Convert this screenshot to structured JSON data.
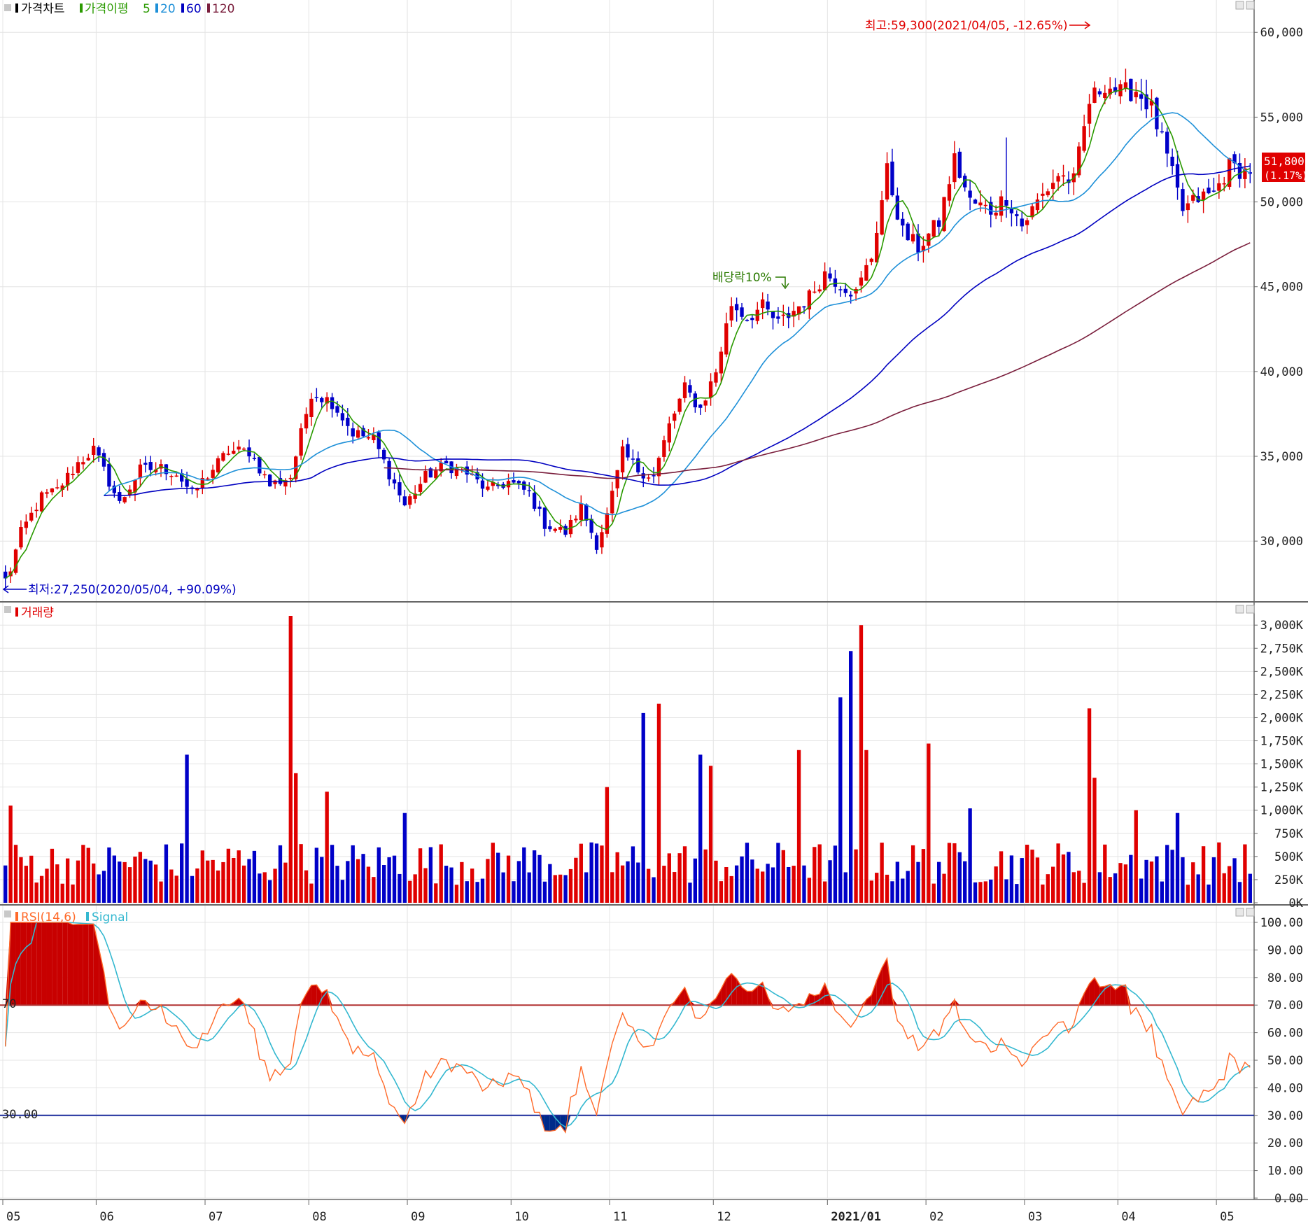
{
  "colors": {
    "up": "#e00000",
    "down": "#0000c8",
    "ma5": "#2a9a00",
    "ma20": "#1e90d8",
    "ma60": "#0000c0",
    "ma120": "#7a1e3c",
    "grid": "#e4e4e4",
    "rsi": "#ff6a2a",
    "signal": "#34b8d0",
    "rsi_hi": "#c80000",
    "rsi_lo": "#002a8a",
    "price_box": "#e00000"
  },
  "price_panel": {
    "legend": {
      "title": "가격차트",
      "ma_label": "가격이평",
      "periods": [
        "5",
        "20",
        "60",
        "120"
      ]
    },
    "high_label": "최고:59,300(2021/04/05, -12.65%)",
    "low_label": "최저:27,250(2020/05/04, +90.09%)",
    "dividend_label": "배당락10%",
    "current_price": "51,800",
    "current_change": "(1.17%)",
    "yticks": [
      "60,000",
      "55,000",
      "50,000",
      "45,000",
      "40,000",
      "35,000",
      "30,000"
    ]
  },
  "volume_panel": {
    "legend": "거래량",
    "yticks": [
      "3,000K",
      "2,750K",
      "2,500K",
      "2,250K",
      "2,000K",
      "1,750K",
      "1,500K",
      "1,250K",
      "1,000K",
      "750K",
      "500K",
      "250K",
      "0K"
    ]
  },
  "rsi_panel": {
    "legend": "RSI(14,6)",
    "signal_label": "Signal",
    "level_70": "70",
    "level_30": "30.00",
    "yticks": [
      "100.00",
      "90.00",
      "80.00",
      "70.00",
      "60.00",
      "50.00",
      "40.00",
      "30.00",
      "20.00",
      "10.00",
      "0.00"
    ]
  },
  "xaxis": {
    "labels": [
      "05",
      "06",
      "07",
      "08",
      "09",
      "10",
      "11",
      "12",
      "2021/01",
      "02",
      "03",
      "04",
      "05"
    ]
  },
  "chart_data": [
    {
      "type": "candlestick",
      "panel": "price",
      "ylim": [
        26500,
        61000
      ],
      "series": [
        {
          "name": "가격차트",
          "anchors": [
            [
              0,
              27250
            ],
            [
              3,
              30500
            ],
            [
              7,
              32600
            ],
            [
              10,
              33000
            ],
            [
              14,
              34600
            ],
            [
              17,
              35400
            ],
            [
              20,
              33500
            ],
            [
              22,
              32200
            ],
            [
              26,
              34200
            ],
            [
              30,
              34300
            ],
            [
              33,
              34000
            ],
            [
              36,
              32800
            ],
            [
              39,
              33900
            ],
            [
              43,
              35300
            ],
            [
              47,
              35300
            ],
            [
              51,
              33300
            ],
            [
              55,
              33800
            ],
            [
              59,
              38800
            ],
            [
              63,
              38200
            ],
            [
              67,
              36400
            ],
            [
              71,
              36000
            ],
            [
              74,
              34000
            ],
            [
              77,
              32100
            ],
            [
              81,
              33800
            ],
            [
              85,
              34500
            ],
            [
              89,
              34000
            ],
            [
              93,
              33000
            ],
            [
              97,
              33500
            ],
            [
              101,
              32800
            ],
            [
              104,
              31000
            ],
            [
              108,
              30500
            ],
            [
              111,
              32000
            ],
            [
              114,
              29800
            ],
            [
              116,
              31500
            ],
            [
              119,
              35200
            ],
            [
              122,
              34200
            ],
            [
              125,
              33800
            ],
            [
              128,
              36800
            ],
            [
              131,
              39000
            ],
            [
              134,
              37800
            ],
            [
              137,
              40000
            ],
            [
              140,
              44000
            ],
            [
              143,
              43200
            ],
            [
              146,
              43800
            ],
            [
              149,
              42800
            ],
            [
              152,
              43600
            ],
            [
              155,
              44400
            ],
            [
              158,
              45800
            ],
            [
              161,
              45200
            ],
            [
              164,
              44600
            ],
            [
              167,
              46800
            ],
            [
              170,
              51800
            ],
            [
              173,
              48200
            ],
            [
              176,
              47300
            ],
            [
              180,
              48800
            ],
            [
              183,
              52500
            ],
            [
              186,
              50000
            ],
            [
              190,
              49500
            ],
            [
              193,
              50300
            ],
            [
              196,
              48600
            ],
            [
              199,
              50000
            ],
            [
              203,
              51600
            ],
            [
              206,
              51200
            ],
            [
              209,
              55900
            ],
            [
              212,
              57000
            ],
            [
              215,
              56400
            ],
            [
              218,
              56600
            ],
            [
              221,
              55500
            ],
            [
              224,
              52600
            ],
            [
              227,
              49500
            ],
            [
              230,
              50200
            ],
            [
              233,
              50500
            ],
            [
              236,
              52100
            ],
            [
              239,
              51800
            ]
          ]
        }
      ]
    },
    {
      "type": "line",
      "panel": "price",
      "series": [
        {
          "name": "5",
          "source": "ma",
          "period": 5
        },
        {
          "name": "20",
          "source": "ma",
          "period": 20
        },
        {
          "name": "60",
          "source": "ma",
          "period": 60
        },
        {
          "name": "120",
          "source": "ma",
          "period": 120
        }
      ]
    },
    {
      "type": "bar",
      "panel": "volume",
      "ylim": [
        0,
        3100000
      ],
      "series": [
        {
          "name": "거래량",
          "peaks": [
            [
              1,
              1050000
            ],
            [
              35,
              1600000
            ],
            [
              55,
              3100000
            ],
            [
              56,
              1400000
            ],
            [
              62,
              1200000
            ],
            [
              77,
              970000
            ],
            [
              116,
              1250000
            ],
            [
              123,
              2050000
            ],
            [
              126,
              2150000
            ],
            [
              134,
              1600000
            ],
            [
              136,
              1480000
            ],
            [
              153,
              1650000
            ],
            [
              161,
              2220000
            ],
            [
              163,
              2720000
            ],
            [
              165,
              3000000
            ],
            [
              166,
              1650000
            ],
            [
              178,
              1720000
            ],
            [
              186,
              1020000
            ],
            [
              209,
              2100000
            ],
            [
              210,
              1350000
            ],
            [
              218,
              1000000
            ],
            [
              226,
              970000
            ]
          ],
          "base": 430000
        }
      ]
    },
    {
      "type": "line",
      "panel": "rsi",
      "ylim": [
        0,
        100
      ],
      "series": [
        {
          "name": "RSI(14,6)",
          "source": "rsi",
          "period": 14
        },
        {
          "name": "Signal",
          "source": "rsi_signal",
          "period": 6
        }
      ]
    }
  ]
}
